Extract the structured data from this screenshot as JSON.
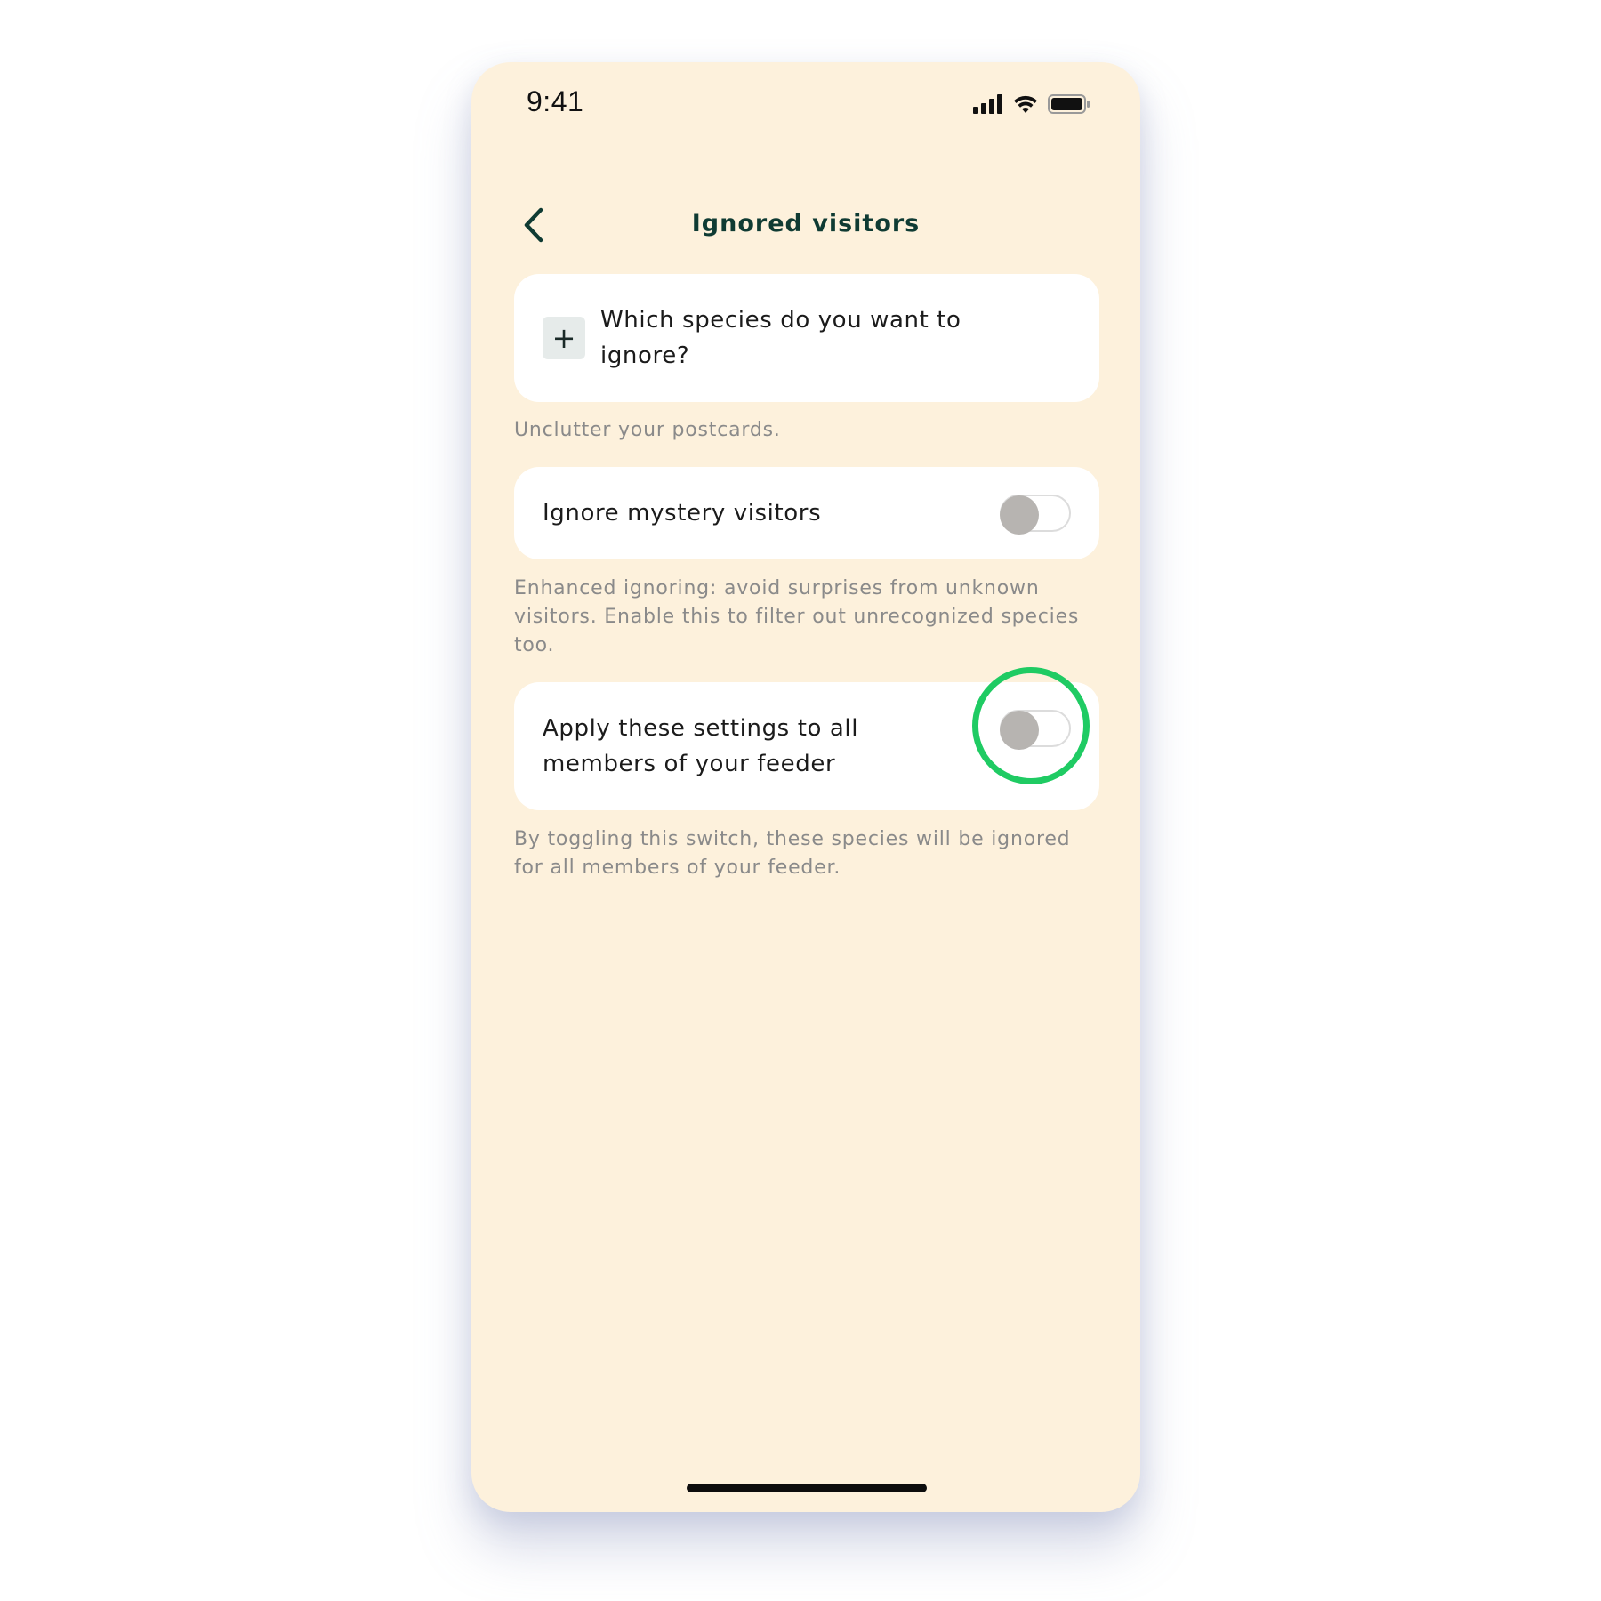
{
  "status_bar": {
    "time": "9:41",
    "signal_icon": "cellular-signal-icon",
    "wifi_icon": "wifi-icon",
    "battery_icon": "battery-icon"
  },
  "header": {
    "title": "Ignored visitors",
    "back_icon": "chevron-left-icon"
  },
  "species_card": {
    "add_icon": "plus-icon",
    "add_symbol": "+",
    "label": "Which species do you want to ignore?",
    "hint": "Unclutter your postcards."
  },
  "mystery_card": {
    "label": "Ignore mystery visitors",
    "toggle_on": false,
    "hint": "Enhanced ignoring: avoid surprises from unknown visitors. Enable this to filter out unrecognized species too."
  },
  "apply_card": {
    "label": "Apply these settings to all members of your feeder",
    "toggle_on": false,
    "hint": "By toggling this switch, these species will be ignored for all members of your feeder."
  },
  "colors": {
    "background": "#fdf1dc",
    "title": "#0f3b33",
    "highlight": "#1fcb63",
    "toggle_knob": "#b7b4b1"
  }
}
